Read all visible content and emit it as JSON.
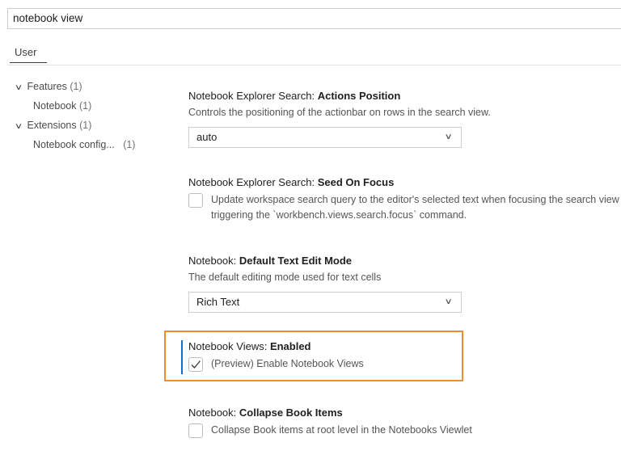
{
  "search": {
    "value": "notebook view"
  },
  "tabs": [
    {
      "label": "User"
    }
  ],
  "toc": [
    {
      "label": "Features",
      "count": "(1)",
      "expanded": true
    },
    {
      "label": "Notebook",
      "count": "(1)"
    },
    {
      "label": "Extensions",
      "count": "(1)",
      "expanded": true
    },
    {
      "label": "Notebook config...",
      "count": "(1)"
    }
  ],
  "settings": [
    {
      "category": "Notebook Explorer Search: ",
      "name": "Actions Position",
      "description": "Controls the positioning of the actionbar on rows in the search view.",
      "control": "select",
      "value": "auto"
    },
    {
      "category": "Notebook Explorer Search: ",
      "name": "Seed On Focus",
      "control": "checkbox",
      "checked": false,
      "label_line1": "Update workspace search query to the editor's selected text when focusing the search view",
      "label_line2": "triggering the `workbench.views.search.focus` command."
    },
    {
      "category": "Notebook: ",
      "name": "Default Text Edit Mode",
      "description": "The default editing mode used for text cells",
      "control": "select",
      "value": "Rich Text"
    },
    {
      "category": "Notebook Views: ",
      "name": "Enabled",
      "control": "checkbox",
      "checked": true,
      "label": "(Preview) Enable Notebook Views"
    },
    {
      "category": "Notebook: ",
      "name": "Collapse Book Items",
      "control": "checkbox",
      "checked": false,
      "label": "Collapse Book items at root level in the Notebooks Viewlet"
    }
  ],
  "colors": {
    "highlight": "#f08c2b",
    "focus": "#0e6ed1"
  }
}
